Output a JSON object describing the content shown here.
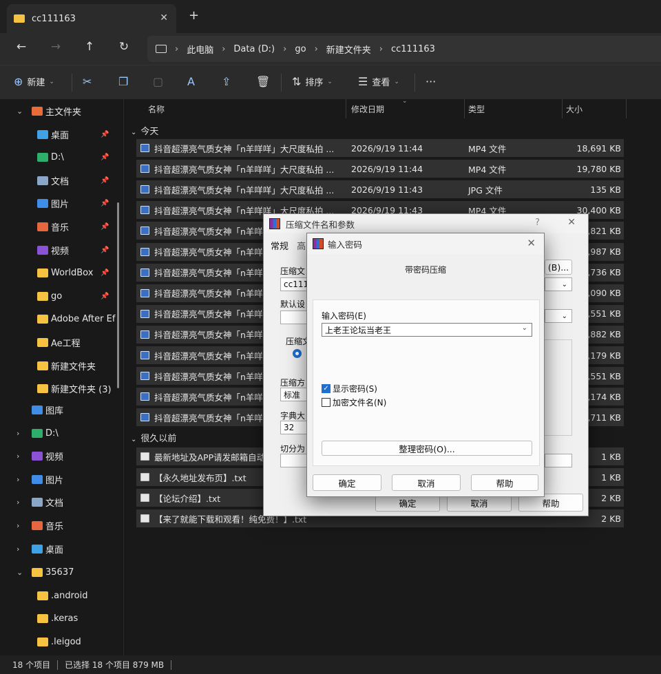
{
  "tab": {
    "title": "cc111163",
    "close": "✕",
    "new": "+"
  },
  "breadcrumbs": [
    "此电脑",
    "Data (D:)",
    "go",
    "新建文件夹",
    "cc111163"
  ],
  "toolbar": {
    "new_label": "新建",
    "sort_label": "排序",
    "view_label": "查看",
    "more": "···"
  },
  "sidebar": {
    "home": "主文件夹",
    "items": [
      {
        "label": "桌面",
        "pinned": true,
        "icon": "desktop-icon",
        "color": "#3fa2e6"
      },
      {
        "label": "D:\\",
        "pinned": true,
        "icon": "download-icon",
        "color": "#2fae6b"
      },
      {
        "label": "文档",
        "pinned": true,
        "icon": "document-icon",
        "color": "#8aa7c7"
      },
      {
        "label": "图片",
        "pinned": true,
        "icon": "pictures-icon",
        "color": "#3f8de6"
      },
      {
        "label": "音乐",
        "pinned": true,
        "icon": "music-icon",
        "color": "#e6673f"
      },
      {
        "label": "视频",
        "pinned": true,
        "icon": "video-icon",
        "color": "#8b52d6"
      },
      {
        "label": "WorldBox",
        "pinned": true,
        "icon": "folder-icon",
        "color": "#f5c242"
      },
      {
        "label": "go",
        "pinned": true,
        "icon": "folder-icon",
        "color": "#f5c242"
      },
      {
        "label": "Adobe After Ef",
        "pinned": false,
        "icon": "folder-icon",
        "color": "#f5c242"
      },
      {
        "label": "Ae工程",
        "pinned": false,
        "icon": "folder-icon",
        "color": "#f5c242"
      },
      {
        "label": "新建文件夹",
        "pinned": false,
        "icon": "folder-icon",
        "color": "#f5c242"
      },
      {
        "label": "新建文件夹 (3)",
        "pinned": false,
        "icon": "folder-icon",
        "color": "#f5c242"
      }
    ],
    "gallery": "图库",
    "tree": [
      {
        "label": "D:\\",
        "icon": "download-icon",
        "color": "#2fae6b"
      },
      {
        "label": "视频",
        "icon": "video-icon",
        "color": "#8b52d6"
      },
      {
        "label": "图片",
        "icon": "pictures-icon",
        "color": "#3f8de6"
      },
      {
        "label": "文档",
        "icon": "document-icon",
        "color": "#8aa7c7"
      },
      {
        "label": "音乐",
        "icon": "music-icon",
        "color": "#e6673f"
      },
      {
        "label": "桌面",
        "icon": "desktop-icon",
        "color": "#3fa2e6"
      }
    ],
    "user_folder": "35637",
    "user_children": [
      ".android",
      ".keras",
      ".leigod"
    ]
  },
  "columns": {
    "name": "名称",
    "date": "修改日期",
    "type": "类型",
    "size": "大小"
  },
  "groups": {
    "today": "今天",
    "older": "很久以前"
  },
  "files_today": [
    {
      "name": "抖音超漂亮气质女神「n羊咩咩」大尺度私拍 ...",
      "date": "2026/9/19 11:44",
      "type": "MP4 文件",
      "size": "18,691 KB"
    },
    {
      "name": "抖音超漂亮气质女神「n羊咩咩」大尺度私拍 ...",
      "date": "2026/9/19 11:44",
      "type": "MP4 文件",
      "size": "19,780 KB"
    },
    {
      "name": "抖音超漂亮气质女神「n羊咩咩」大尺度私拍 ...",
      "date": "2026/9/19 11:43",
      "type": "JPG 文件",
      "size": "135 KB"
    },
    {
      "name": "抖音超漂亮气质女神「n羊咩咩」大尺度私拍 ...",
      "date": "2026/9/19 11:43",
      "type": "MP4 文件",
      "size": "30,400 KB"
    },
    {
      "name": "抖音超漂亮气质女神「n羊咩",
      "date": "",
      "type": "",
      "size": ",821 KB"
    },
    {
      "name": "抖音超漂亮气质女神「n羊咩",
      "date": "",
      "type": "",
      "size": ",987 KB"
    },
    {
      "name": "抖音超漂亮气质女神「n羊咩",
      "date": "",
      "type": "",
      "size": ",736 KB"
    },
    {
      "name": "抖音超漂亮气质女神「n羊咩",
      "date": "",
      "type": "",
      "size": ",090 KB"
    },
    {
      "name": "抖音超漂亮气质女神「n羊咩",
      "date": "",
      "type": "",
      "size": ",551 KB"
    },
    {
      "name": "抖音超漂亮气质女神「n羊咩",
      "date": "",
      "type": "",
      "size": ",882 KB"
    },
    {
      "name": "抖音超漂亮气质女神「n羊咩",
      "date": "",
      "type": "",
      "size": ",179 KB"
    },
    {
      "name": "抖音超漂亮气质女神「n羊咩",
      "date": "",
      "type": "",
      "size": ",551 KB"
    },
    {
      "name": "抖音超漂亮气质女神「n羊咩",
      "date": "",
      "type": "",
      "size": ",174 KB"
    },
    {
      "name": "抖音超漂亮气质女神「n羊咩",
      "date": "",
      "type": "",
      "size": ",711 KB"
    }
  ],
  "files_older": [
    {
      "name": "最新地址及APP请发邮箱自动",
      "date": "",
      "type": "",
      "size": "1 KB"
    },
    {
      "name": "【永久地址发布页】.txt",
      "date": "",
      "type": "",
      "size": "1 KB"
    },
    {
      "name": "【论坛介绍】.txt",
      "date": "",
      "type": "",
      "size": "2 KB"
    },
    {
      "name": "【来了就能下载和观看！纯免费！】.txt",
      "date": "",
      "type": "",
      "size": "2 KB"
    }
  ],
  "status": {
    "count": "18 个项目",
    "selected": "已选择 18 个项目  879 MB"
  },
  "archive_dialog": {
    "title": "压缩文件名和参数",
    "help": "?",
    "close": "✕",
    "tab_general": "常规",
    "tab_advanced": "高",
    "archive_name_label": "压缩文",
    "archive_name_value": "cc111",
    "browse_label": "(B)...",
    "profile_label": "默认设",
    "format_label": "压缩文",
    "method_label": "压缩方",
    "method_value": "标准",
    "dict_label": "字典大",
    "dict_value": "32",
    "split_label": "切分为",
    "ok": "确定",
    "cancel": "取消",
    "help_btn": "帮助"
  },
  "password_dialog": {
    "title": "输入密码",
    "close": "✕",
    "header": "带密码压缩",
    "enter_label": "输入密码(E)",
    "password_value": "上老王论坛当老王",
    "show_password": "显示密码(S)",
    "show_password_checked": true,
    "encrypt_names": "加密文件名(N)",
    "encrypt_names_checked": false,
    "organize": "整理密码(O)...",
    "ok": "确定",
    "cancel": "取消",
    "help": "帮助"
  }
}
